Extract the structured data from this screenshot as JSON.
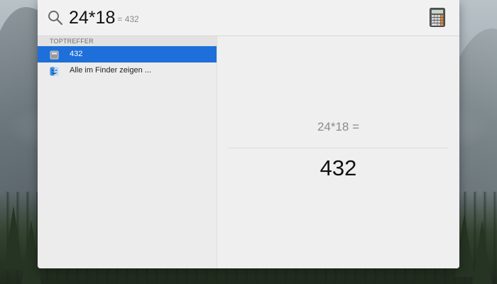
{
  "spotlight": {
    "query": "24*18",
    "inline_result": "= 432",
    "app_icon": "calculator-icon",
    "search_icon": "search-icon"
  },
  "results": {
    "section_header": "TOPTREFFER",
    "items": [
      {
        "label": "432",
        "icon": "calculator-result-icon",
        "selected": true
      },
      {
        "label": "Alle im Finder zeigen ...",
        "icon": "finder-icon",
        "selected": false
      }
    ]
  },
  "preview": {
    "expression": "24*18 =",
    "answer": "432"
  },
  "colors": {
    "selection": "#1e6fd9",
    "panel": "#ececec"
  }
}
